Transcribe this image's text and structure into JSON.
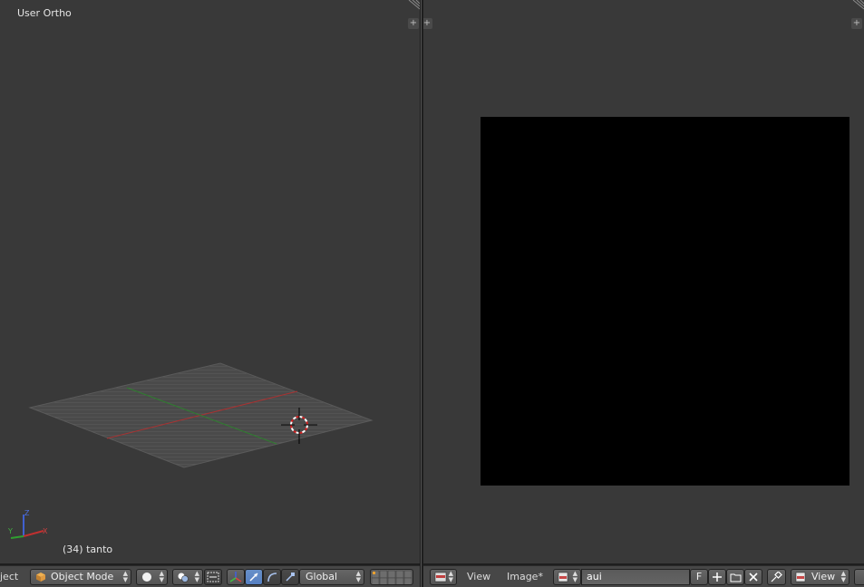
{
  "viewport3d": {
    "view_label": "User Ortho",
    "object_label": "(34) tanto",
    "axis_labels": {
      "x": "X",
      "y": "Y",
      "z": "Z"
    }
  },
  "header3d": {
    "menu_partial": "ject",
    "mode": "Object Mode",
    "orientation": "Global"
  },
  "image_header": {
    "menu_view": "View",
    "menu_image": "Image*",
    "image_name": "aui",
    "fake_user": "F",
    "view_select": "View"
  },
  "colors": {
    "area_bg": "#393939",
    "header_bg": "#474747",
    "grid": "#6e6e6e",
    "x_axis": "#b03030",
    "y_axis": "#3a8a3a",
    "active_blue": "#5680c2"
  },
  "icons": [
    "viewport-plus-icon",
    "cube-icon",
    "shading-sphere-icon",
    "pivot-icon",
    "manipulator-icon",
    "translate-icon",
    "rotate-icon",
    "scale-icon",
    "layers-icon",
    "editor-type-icon",
    "image-browse-icon",
    "new-image-icon",
    "open-folder-icon",
    "close-icon",
    "pin-icon",
    "display-channel-icon"
  ]
}
